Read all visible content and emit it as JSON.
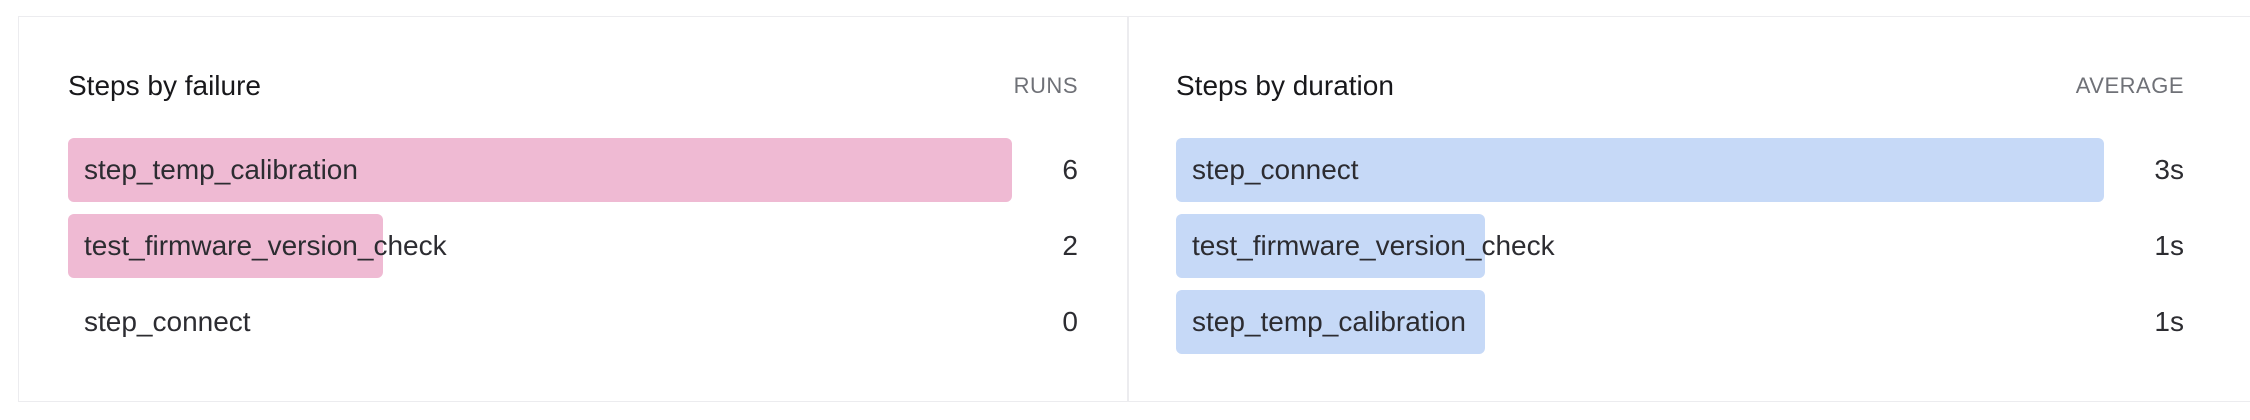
{
  "colors": {
    "failure_bar": "#efbad3",
    "duration_bar": "#c6d9f7"
  },
  "failure_panel": {
    "title": "Steps by failure",
    "metric_label": "RUNS",
    "max_value": 6,
    "rows": [
      {
        "label": "step_temp_calibration",
        "value_label": "6",
        "value": 6
      },
      {
        "label": "test_firmware_version_check",
        "value_label": "2",
        "value": 2
      },
      {
        "label": "step_connect",
        "value_label": "0",
        "value": 0
      }
    ]
  },
  "duration_panel": {
    "title": "Steps by duration",
    "metric_label": "AVERAGE",
    "max_value": 3,
    "rows": [
      {
        "label": "step_connect",
        "value_label": "3s",
        "value": 3
      },
      {
        "label": "test_firmware_version_check",
        "value_label": "1s",
        "value": 1
      },
      {
        "label": "step_temp_calibration",
        "value_label": "1s",
        "value": 1
      }
    ]
  }
}
